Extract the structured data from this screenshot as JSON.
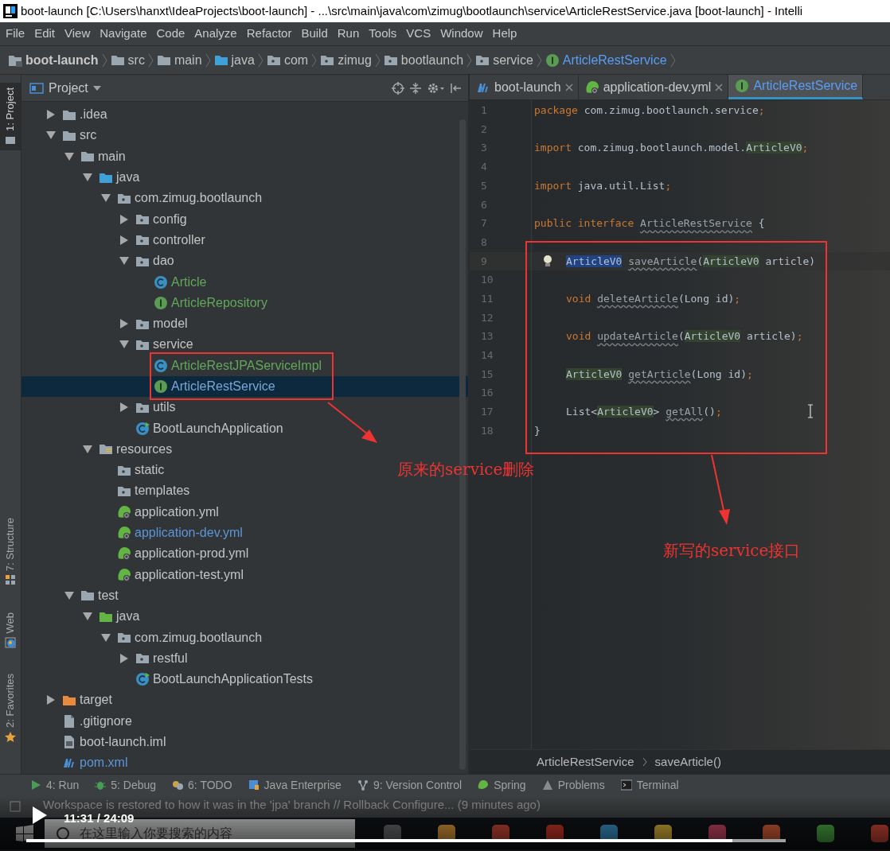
{
  "window": {
    "title": "boot-launch [C:\\Users\\hanxt\\IdeaProjects\\boot-launch] - ...\\src\\main\\java\\com\\zimug\\bootlaunch\\service\\ArticleRestService.java [boot-launch] - Intelli"
  },
  "menu": [
    "File",
    "Edit",
    "View",
    "Navigate",
    "Code",
    "Analyze",
    "Refactor",
    "Build",
    "Run",
    "Tools",
    "VCS",
    "Window",
    "Help"
  ],
  "breadcrumbs": [
    {
      "label": "boot-launch",
      "kind": "project"
    },
    {
      "label": "src",
      "kind": "folder"
    },
    {
      "label": "main",
      "kind": "folder"
    },
    {
      "label": "java",
      "kind": "source-root"
    },
    {
      "label": "com",
      "kind": "package"
    },
    {
      "label": "zimug",
      "kind": "package"
    },
    {
      "label": "bootlaunch",
      "kind": "package"
    },
    {
      "label": "service",
      "kind": "package"
    },
    {
      "label": "ArticleRestService",
      "kind": "interface"
    }
  ],
  "side_tabs": [
    {
      "label": "1: Project",
      "selected": true,
      "kind": "project"
    },
    {
      "label": "7: Structure",
      "selected": false,
      "kind": "structure"
    },
    {
      "label": "Web",
      "selected": false,
      "kind": "web"
    },
    {
      "label": "2: Favorites",
      "selected": false,
      "kind": "favorites"
    }
  ],
  "project_panel": {
    "title": "Project",
    "tree": [
      {
        "label": ".idea",
        "kind": "folder",
        "expanded": false,
        "selected": false
      },
      {
        "label": "src",
        "kind": "folder",
        "expanded": true,
        "selected": false,
        "children": [
          {
            "label": "main",
            "kind": "folder",
            "expanded": true,
            "selected": false,
            "children": [
              {
                "label": "java",
                "kind": "source-root",
                "expanded": true,
                "selected": false,
                "children": [
                  {
                    "label": "com.zimug.bootlaunch",
                    "kind": "package",
                    "expanded": true,
                    "selected": false,
                    "children": [
                      {
                        "label": "config",
                        "kind": "package",
                        "expanded": false,
                        "selected": false
                      },
                      {
                        "label": "controller",
                        "kind": "package",
                        "expanded": false,
                        "selected": false
                      },
                      {
                        "label": "dao",
                        "kind": "package",
                        "expanded": true,
                        "selected": false,
                        "children": [
                          {
                            "label": "Article",
                            "kind": "class",
                            "selected": false,
                            "color": "#62a85b"
                          },
                          {
                            "label": "ArticleRepository",
                            "kind": "interface",
                            "selected": false,
                            "color": "#62a85b"
                          }
                        ]
                      },
                      {
                        "label": "model",
                        "kind": "package",
                        "expanded": false,
                        "selected": false
                      },
                      {
                        "label": "service",
                        "kind": "package",
                        "expanded": true,
                        "selected": false,
                        "children": [
                          {
                            "label": "ArticleRestJPAServiceImpl",
                            "kind": "class",
                            "selected": false,
                            "color": "#62a85b"
                          },
                          {
                            "label": "ArticleRestService",
                            "kind": "interface",
                            "selected": true
                          }
                        ]
                      },
                      {
                        "label": "utils",
                        "kind": "package",
                        "expanded": false,
                        "selected": false
                      },
                      {
                        "label": "BootLaunchApplication",
                        "kind": "app-class",
                        "selected": false
                      }
                    ]
                  }
                ]
              },
              {
                "label": "resources",
                "kind": "resources-root",
                "expanded": true,
                "selected": false,
                "children": [
                  {
                    "label": "static",
                    "kind": "package",
                    "selected": false
                  },
                  {
                    "label": "templates",
                    "kind": "package",
                    "selected": false
                  },
                  {
                    "label": "application.yml",
                    "kind": "yml",
                    "selected": false
                  },
                  {
                    "label": "application-dev.yml",
                    "kind": "yml",
                    "selected": false,
                    "color": "#5d95d8"
                  },
                  {
                    "label": "application-prod.yml",
                    "kind": "yml",
                    "selected": false
                  },
                  {
                    "label": "application-test.yml",
                    "kind": "yml",
                    "selected": false
                  }
                ]
              }
            ]
          },
          {
            "label": "test",
            "kind": "folder",
            "expanded": true,
            "selected": false,
            "children": [
              {
                "label": "java",
                "kind": "test-root",
                "expanded": true,
                "selected": false,
                "children": [
                  {
                    "label": "com.zimug.bootlaunch",
                    "kind": "package",
                    "expanded": true,
                    "selected": false,
                    "children": [
                      {
                        "label": "restful",
                        "kind": "package",
                        "expanded": false,
                        "selected": false
                      },
                      {
                        "label": "BootLaunchApplicationTests",
                        "kind": "app-class",
                        "selected": false
                      }
                    ]
                  }
                ]
              }
            ]
          }
        ]
      },
      {
        "label": "target",
        "kind": "excluded-folder",
        "expanded": false,
        "selected": false
      },
      {
        "label": ".gitignore",
        "kind": "file",
        "selected": false
      },
      {
        "label": "boot-launch.iml",
        "kind": "iml",
        "selected": false
      },
      {
        "label": "pom.xml",
        "kind": "maven",
        "selected": false,
        "color": "#5d95d8"
      }
    ]
  },
  "editor": {
    "tabs": [
      {
        "label": "boot-launch",
        "kind": "maven",
        "selected": false
      },
      {
        "label": "application-dev.yml",
        "kind": "yml",
        "selected": false
      },
      {
        "label": "ArticleRestService",
        "kind": "interface",
        "selected": true
      }
    ],
    "lines": [
      {
        "number": "1",
        "tokens": [
          {
            "text": "package",
            "kind": "kw"
          },
          {
            "text": " com.zimug.bootlaunch.service",
            "kind": "plain"
          },
          {
            "text": ";",
            "kind": "punct"
          }
        ]
      },
      {
        "number": "2"
      },
      {
        "number": "3",
        "tokens": [
          {
            "text": "import",
            "kind": "kw"
          },
          {
            "text": " com.zimug.bootlaunch.model.",
            "kind": "plain"
          },
          {
            "text": "ArticleV0",
            "kind": "type"
          },
          {
            "text": ";",
            "kind": "punct"
          }
        ]
      },
      {
        "number": "4"
      },
      {
        "number": "5",
        "tokens": [
          {
            "text": "import",
            "kind": "kw"
          },
          {
            "text": " java.util.List",
            "kind": "plain"
          },
          {
            "text": ";",
            "kind": "punct"
          }
        ]
      },
      {
        "number": "6"
      },
      {
        "number": "7",
        "tokens": [
          {
            "text": "public interface",
            "kind": "kw"
          },
          {
            "text": " ArticleRestService",
            "kind": "unused"
          },
          {
            "text": " {",
            "kind": "plain"
          }
        ]
      },
      {
        "number": "8"
      },
      {
        "number": "9",
        "indented": true,
        "current": true,
        "tokens": [
          {
            "text": "ArticleV0",
            "kind": "selected"
          },
          {
            "text": " saveArticle",
            "kind": "unused"
          },
          {
            "text": "(",
            "kind": "plain"
          },
          {
            "text": "ArticleV0",
            "kind": "type"
          },
          {
            "text": " article)",
            "kind": "plain"
          }
        ]
      },
      {
        "number": "10"
      },
      {
        "number": "11",
        "indented": true,
        "tokens": [
          {
            "text": "void",
            "kind": "kw"
          },
          {
            "text": " deleteArticle",
            "kind": "unused"
          },
          {
            "text": "(Long id)",
            "kind": "plain"
          },
          {
            "text": ";",
            "kind": "punct"
          }
        ]
      },
      {
        "number": "12"
      },
      {
        "number": "13",
        "indented": true,
        "tokens": [
          {
            "text": "void",
            "kind": "kw"
          },
          {
            "text": " updateArticle",
            "kind": "unused"
          },
          {
            "text": "(",
            "kind": "plain"
          },
          {
            "text": "ArticleV0",
            "kind": "type"
          },
          {
            "text": " article)",
            "kind": "plain"
          },
          {
            "text": ";",
            "kind": "punct"
          }
        ]
      },
      {
        "number": "14"
      },
      {
        "number": "15",
        "indented": true,
        "tokens": [
          {
            "text": "ArticleV0",
            "kind": "type"
          },
          {
            "text": " getArticle",
            "kind": "unused"
          },
          {
            "text": "(Long id)",
            "kind": "plain"
          },
          {
            "text": ";",
            "kind": "punct"
          }
        ]
      },
      {
        "number": "16"
      },
      {
        "number": "17",
        "indented": true,
        "tokens": [
          {
            "text": "List<",
            "kind": "plain"
          },
          {
            "text": "ArticleV0",
            "kind": "type"
          },
          {
            "text": ">",
            "kind": "plain"
          },
          {
            "text": " getAll",
            "kind": "unused"
          },
          {
            "text": "()",
            "kind": "plain"
          },
          {
            "text": ";",
            "kind": "punct"
          }
        ]
      },
      {
        "number": "18",
        "tokens": [
          {
            "text": "}",
            "kind": "plain"
          }
        ]
      }
    ],
    "breadcrumbs": [
      "ArticleRestService",
      "saveArticle()"
    ]
  },
  "annotations": [
    {
      "text": "原来的service删除"
    },
    {
      "text": "新写的service接口"
    }
  ],
  "tool_windows": [
    {
      "label": "4: Run",
      "kind": "run"
    },
    {
      "label": "5: Debug",
      "kind": "debug"
    },
    {
      "label": "6: TODO",
      "kind": "todo"
    },
    {
      "label": "Java Enterprise",
      "kind": "enterprise"
    },
    {
      "label": "9: Version Control",
      "kind": "vcs"
    },
    {
      "label": "Spring",
      "kind": "spring"
    },
    {
      "label": "Problems",
      "kind": "problems"
    },
    {
      "label": "Terminal",
      "kind": "terminal"
    }
  ],
  "status_bar": {
    "message": "Workspace is restored to how it was in the 'jpa' branch // Rollback Configure... (9 minutes ago)"
  },
  "video_player": {
    "time": "11:31 / 24:09",
    "level": 0.93
  },
  "taskbar": {
    "search": {
      "placeholder": "在这里输入你要搜索的内容"
    }
  }
}
